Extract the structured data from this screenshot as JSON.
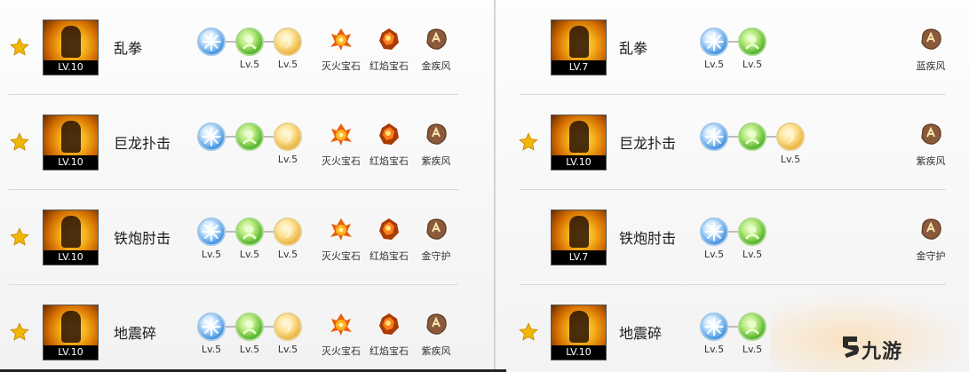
{
  "left": {
    "rows": [
      {
        "skill": "乱拳",
        "level": "LV.10",
        "starred": true,
        "runes": [
          {
            "color": "blue",
            "label": ""
          },
          {
            "color": "green",
            "label": "Lv.5"
          },
          {
            "color": "gold",
            "label": "Lv.5"
          }
        ],
        "gems": [
          {
            "name": "fire-gem",
            "label": "灭火宝石"
          },
          {
            "name": "lava-gem",
            "label": "红焰宝石"
          },
          {
            "name": "rune-stone",
            "label": "金疾风"
          }
        ]
      },
      {
        "skill": "巨龙扑击",
        "level": "LV.10",
        "starred": true,
        "runes": [
          {
            "color": "blue",
            "label": ""
          },
          {
            "color": "green",
            "label": ""
          },
          {
            "color": "gold",
            "label": "Lv.5"
          }
        ],
        "gems": [
          {
            "name": "fire-gem",
            "label": "灭火宝石"
          },
          {
            "name": "lava-gem",
            "label": "红焰宝石"
          },
          {
            "name": "rune-stone",
            "label": "紫疾风"
          }
        ]
      },
      {
        "skill": "铁炮肘击",
        "level": "LV.10",
        "starred": true,
        "runes": [
          {
            "color": "blue",
            "label": "Lv.5"
          },
          {
            "color": "green",
            "label": "Lv.5"
          },
          {
            "color": "gold",
            "label": "Lv.5"
          }
        ],
        "gems": [
          {
            "name": "fire-gem",
            "label": "灭火宝石"
          },
          {
            "name": "lava-gem",
            "label": "红焰宝石"
          },
          {
            "name": "rune-stone",
            "label": "金守护"
          }
        ]
      },
      {
        "skill": "地震碎",
        "level": "LV.10",
        "starred": true,
        "runes": [
          {
            "color": "blue",
            "label": "Lv.5"
          },
          {
            "color": "green",
            "label": "Lv.5"
          },
          {
            "color": "gold",
            "label": "Lv.5"
          }
        ],
        "gems": [
          {
            "name": "fire-gem",
            "label": "灭火宝石"
          },
          {
            "name": "lava-gem",
            "label": "红焰宝石"
          },
          {
            "name": "rune-stone",
            "label": "紫疾风"
          }
        ]
      }
    ]
  },
  "right": {
    "rows": [
      {
        "skill": "乱拳",
        "level": "LV.7",
        "starred": false,
        "runes": [
          {
            "color": "blue",
            "label": "Lv.5"
          },
          {
            "color": "green",
            "label": "Lv.5"
          }
        ],
        "gem": {
          "name": "rune-stone",
          "label": "蓝疾风"
        }
      },
      {
        "skill": "巨龙扑击",
        "level": "LV.10",
        "starred": true,
        "runes": [
          {
            "color": "blue",
            "label": ""
          },
          {
            "color": "green",
            "label": ""
          },
          {
            "color": "gold",
            "label": "Lv.5"
          }
        ],
        "gem": {
          "name": "rune-stone",
          "label": "紫疾风"
        }
      },
      {
        "skill": "铁炮肘击",
        "level": "LV.7",
        "starred": false,
        "runes": [
          {
            "color": "blue",
            "label": "Lv.5"
          },
          {
            "color": "green",
            "label": "Lv.5"
          }
        ],
        "gem": {
          "name": "rune-stone",
          "label": "金守护"
        }
      },
      {
        "skill": "地震碎",
        "level": "LV.10",
        "starred": true,
        "runes": [
          {
            "color": "blue",
            "label": "Lv.5"
          },
          {
            "color": "green",
            "label": "Lv.5"
          }
        ],
        "gem": null
      }
    ]
  },
  "watermark": {
    "text": "九游"
  }
}
